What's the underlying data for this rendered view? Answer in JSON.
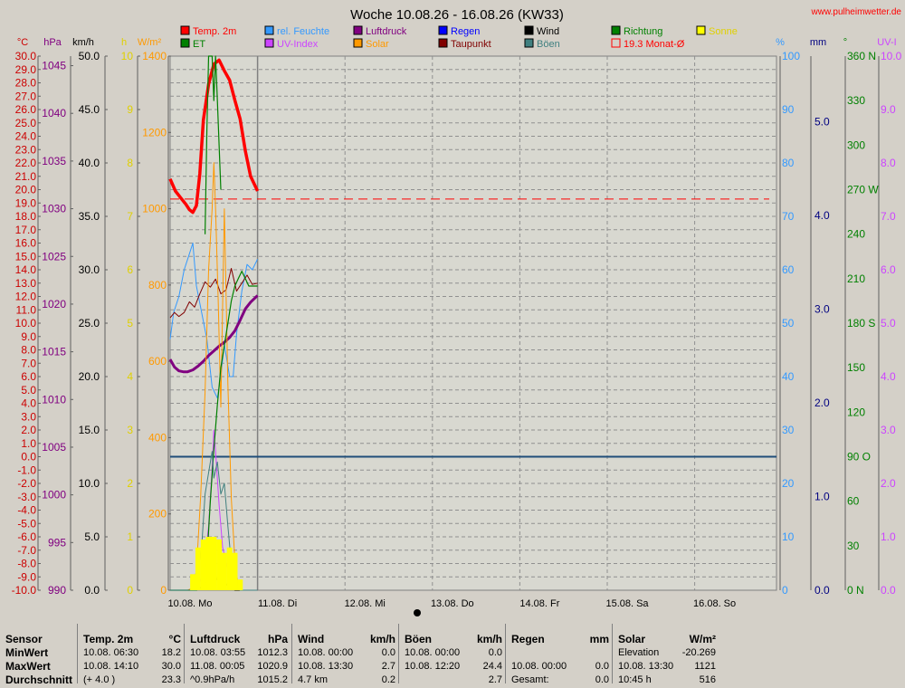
{
  "title": "Woche 10.08.26 - 16.08.26 (KW33)",
  "website": "www.pulheimwetter.de",
  "legend": [
    {
      "label": "Temp. 2m",
      "color": "#ff0000"
    },
    {
      "label": "rel. Feuchte",
      "color": "#3399ff"
    },
    {
      "label": "Luftdruck",
      "color": "#800080"
    },
    {
      "label": "Regen",
      "color": "#0000ff"
    },
    {
      "label": "Wind",
      "color": "#000000"
    },
    {
      "label": "Richtung",
      "color": "#008000"
    },
    {
      "label": "Sonne",
      "color": "#ffff00"
    },
    {
      "label": "ET",
      "color": "#008000"
    },
    {
      "label": "UV-Index",
      "color": "#cc44ff"
    },
    {
      "label": "Solar",
      "color": "#ff9900"
    },
    {
      "label": "Taupunkt",
      "color": "#800000"
    },
    {
      "label": "Böen",
      "color": "#408080"
    },
    {
      "label": "19.3 Monat-Ø",
      "color": "#ff0000"
    }
  ],
  "axis_units": {
    "temp": "°C",
    "pressure": "hPa",
    "wind": "km/h",
    "sun": "h",
    "solar": "W/m²",
    "humidity": "%",
    "rain": "mm",
    "direction": "°",
    "uv": "UV-I"
  },
  "chart_data": {
    "type": "line",
    "title": "Woche 10.08.26 - 16.08.26 (KW33)",
    "x_ticks": [
      "10.08. Mo",
      "11.08. Di",
      "12.08. Mi",
      "13.08. Do",
      "14.08. Fr",
      "15.08. Sa",
      "16.08. So"
    ],
    "axes": {
      "temp": {
        "min": -10,
        "max": 30,
        "ticks": [
          "30.0",
          "29.0",
          "28.0",
          "27.0",
          "26.0",
          "25.0",
          "24.0",
          "23.0",
          "22.0",
          "21.0",
          "20.0",
          "19.0",
          "18.0",
          "17.0",
          "16.0",
          "15.0",
          "14.0",
          "13.0",
          "12.0",
          "11.0",
          "10.0",
          "9.0",
          "8.0",
          "7.0",
          "6.0",
          "5.0",
          "4.0",
          "3.0",
          "2.0",
          "1.0",
          "0.0",
          "-1.0",
          "-2.0",
          "-3.0",
          "-4.0",
          "-5.0",
          "-6.0",
          "-7.0",
          "-8.0",
          "-9.0",
          "-10.0"
        ]
      },
      "pressure": {
        "min": 990,
        "max": 1046,
        "ticks": [
          "1045",
          "1040",
          "1035",
          "1030",
          "1025",
          "1020",
          "1015",
          "1010",
          "1005",
          "1000",
          "995",
          "990"
        ]
      },
      "wind": {
        "min": 0,
        "max": 50,
        "ticks": [
          "50.0",
          "45.0",
          "40.0",
          "35.0",
          "30.0",
          "25.0",
          "20.0",
          "15.0",
          "10.0",
          "5.0",
          "0.0"
        ]
      },
      "sun": {
        "min": 0,
        "max": 10,
        "ticks": [
          "10",
          "9",
          "8",
          "7",
          "6",
          "5",
          "4",
          "3",
          "2",
          "1",
          "0"
        ]
      },
      "solar": {
        "min": 0,
        "max": 1400,
        "ticks": [
          "1400",
          "1200",
          "1000",
          "800",
          "600",
          "400",
          "200",
          "0"
        ]
      },
      "humidity": {
        "min": 0,
        "max": 100,
        "ticks": [
          "100",
          "90",
          "80",
          "70",
          "60",
          "50",
          "40",
          "30",
          "20",
          "10",
          "0"
        ]
      },
      "rain": {
        "min": 0,
        "max": 5.7,
        "ticks": [
          "5.0",
          "4.0",
          "3.0",
          "2.0",
          "1.0",
          "0.0"
        ]
      },
      "direction": {
        "min": 0,
        "max": 360,
        "ticks": [
          "360 N",
          "330",
          "300",
          "270 W",
          "240",
          "210",
          "180 S",
          "150",
          "120",
          "90 O",
          "60",
          "30",
          "0 N"
        ]
      },
      "uv": {
        "min": 0,
        "max": 10,
        "ticks": [
          "10.0",
          "9.0",
          "8.0",
          "7.0",
          "6.0",
          "5.0",
          "4.0",
          "3.0",
          "2.0",
          "1.0",
          "0.0"
        ]
      }
    },
    "series": [
      {
        "name": "Temp. 2m",
        "axis": "temp",
        "color": "#ff0000",
        "x": [
          0,
          0.06,
          0.12,
          0.18,
          0.22,
          0.26,
          0.3,
          0.34,
          0.38,
          0.44,
          0.5,
          0.56,
          0.62,
          0.68,
          0.74,
          0.8,
          0.86,
          0.92,
          1.0
        ],
        "y": [
          20.8,
          19.9,
          19.4,
          18.9,
          18.5,
          18.3,
          18.8,
          21.2,
          25.2,
          27.9,
          29.4,
          29.7,
          28.9,
          28.2,
          26.7,
          25.3,
          22.9,
          21.0,
          19.9
        ]
      },
      {
        "name": "rel. Feuchte",
        "axis": "humidity",
        "color": "#3399ff",
        "x": [
          0,
          0.04,
          0.1,
          0.16,
          0.22,
          0.26,
          0.3,
          0.36,
          0.42,
          0.48,
          0.54,
          0.58,
          0.62,
          0.68,
          0.72,
          0.76,
          0.82,
          0.88,
          0.94,
          1.0
        ],
        "y": [
          47,
          52,
          55,
          60,
          63,
          65,
          57,
          52,
          47,
          38,
          36,
          40,
          46,
          40,
          40,
          48,
          56,
          61,
          60,
          62
        ]
      },
      {
        "name": "Luftdruck",
        "axis": "pressure",
        "color": "#800080",
        "x": [
          0,
          0.05,
          0.1,
          0.15,
          0.2,
          0.26,
          0.32,
          0.38,
          0.44,
          0.5,
          0.56,
          0.62,
          0.68,
          0.74,
          0.8,
          0.86,
          0.92,
          1.0
        ],
        "y": [
          1014.2,
          1013.4,
          1013.0,
          1012.9,
          1012.9,
          1013.1,
          1013.5,
          1014.0,
          1014.6,
          1015.1,
          1015.6,
          1016.0,
          1016.5,
          1017.2,
          1018.3,
          1019.5,
          1020.2,
          1020.9
        ]
      },
      {
        "name": "Taupunkt",
        "axis": "temp",
        "color": "#800000",
        "x": [
          0,
          0.05,
          0.1,
          0.16,
          0.22,
          0.28,
          0.34,
          0.4,
          0.46,
          0.52,
          0.58,
          0.64,
          0.7,
          0.76,
          0.82,
          0.88,
          0.94,
          1.0
        ],
        "y": [
          10.4,
          10.8,
          10.5,
          10.8,
          11.6,
          11.2,
          12.2,
          13.1,
          12.7,
          13.3,
          12.2,
          12.5,
          14.1,
          12.4,
          13.0,
          13.6,
          12.9,
          13.0
        ]
      },
      {
        "name": "Solar",
        "axis": "solar",
        "color": "#ff9900",
        "x": [
          0,
          0.1,
          0.2,
          0.25,
          0.3,
          0.35,
          0.4,
          0.44,
          0.48,
          0.5,
          0.52,
          0.55,
          0.58,
          0.62,
          0.66,
          0.7,
          0.74,
          0.78,
          0.8,
          0.84,
          0.9,
          1.0
        ],
        "y": [
          0,
          0,
          0,
          5,
          50,
          250,
          520,
          840,
          1000,
          1121,
          1000,
          760,
          480,
          1000,
          540,
          240,
          80,
          10,
          0,
          0,
          0,
          0
        ]
      },
      {
        "name": "UV-Index",
        "axis": "uv",
        "color": "#cc44ff",
        "x": [
          0,
          0.3,
          0.38,
          0.44,
          0.48,
          0.5,
          0.52,
          0.56,
          0.6,
          0.66,
          0.7,
          0.76,
          0.8,
          1.0
        ],
        "y": [
          0,
          0,
          0.3,
          1.2,
          2.3,
          3.0,
          2.6,
          1.6,
          0.8,
          0.4,
          0.1,
          0,
          0,
          0
        ]
      },
      {
        "name": "Richtung",
        "axis": "direction",
        "color": "#008000",
        "x": [
          0,
          0.2,
          0.3,
          0.36,
          0.42,
          0.46,
          0.5,
          0.54,
          0.58,
          0.62,
          0.66,
          0.7,
          0.74,
          0.78,
          0.82,
          0.86,
          0.9,
          1.0
        ],
        "y": [
          0,
          0,
          0,
          2,
          20,
          60,
          95,
          125,
          150,
          165,
          180,
          195,
          205,
          210,
          215,
          210,
          205,
          205
        ]
      },
      {
        "name": "Wind",
        "axis": "wind",
        "color": "#000000",
        "x": [
          0,
          0.3,
          0.36,
          0.42,
          0.48,
          0.52,
          0.56,
          0.6,
          0.66,
          0.7,
          0.74,
          1.0
        ],
        "y": [
          0,
          0,
          0.3,
          0.8,
          1.5,
          1.2,
          0.6,
          1.1,
          0.4,
          0.2,
          0,
          0
        ]
      },
      {
        "name": "Böen",
        "axis": "wind",
        "color": "#408080",
        "x": [
          0,
          0.3,
          0.36,
          0.4,
          0.44,
          0.48,
          0.5,
          0.54,
          0.58,
          0.62,
          0.66,
          0.7,
          0.76,
          0.8,
          1.0
        ],
        "y": [
          0,
          0,
          4,
          9,
          11,
          13,
          10.5,
          12,
          9,
          10,
          6,
          2.5,
          0.8,
          0,
          0
        ]
      },
      {
        "name": "Sonne",
        "axis": "sun",
        "color": "#ffff00",
        "type": "bars",
        "x": [
          0.26,
          0.32,
          0.38,
          0.44,
          0.5,
          0.56,
          0.62,
          0.68,
          0.74,
          0.8
        ],
        "y": [
          0.3,
          0.8,
          0.95,
          1.0,
          1.0,
          0.95,
          0.7,
          0.8,
          0.7,
          0.2
        ]
      },
      {
        "name": "ET",
        "axis": "direction",
        "color": "#008000",
        "x": [
          0.4,
          0.42,
          0.44,
          0.46,
          0.48,
          0.5,
          0.52,
          0.54,
          0.56,
          0.58
        ],
        "y": [
          240,
          310,
          370,
          380,
          360,
          330,
          360,
          330,
          300,
          270
        ]
      }
    ],
    "reference_lines": [
      {
        "name": "19.3 Monat-Ø",
        "axis": "temp",
        "value": 19.3,
        "color": "#ff0000",
        "style": "dashed"
      },
      {
        "name": "Regen",
        "axis": "temp",
        "value": 0,
        "color": "#1f4e79",
        "style": "solid"
      }
    ],
    "grid": true
  },
  "stats": {
    "sensor": {
      "header": "Sensor",
      "rows": [
        "MinWert",
        "MaxWert",
        "Durchschnitt"
      ]
    },
    "temp": {
      "header": "Temp. 2m",
      "unit": "°C",
      "rows": [
        [
          "10.08.  06:30",
          "18.2"
        ],
        [
          "10.08.  14:10",
          "30.0"
        ],
        [
          "(+ 4.0 )",
          "23.3"
        ]
      ]
    },
    "pressure": {
      "header": "Luftdruck",
      "unit": "hPa",
      "rows": [
        [
          "10.08.  03:55",
          "1012.3"
        ],
        [
          "11.08.  00:05",
          "1020.9"
        ],
        [
          "^0.9hPa/h",
          "1015.2"
        ]
      ]
    },
    "wind": {
      "header": "Wind",
      "unit": "km/h",
      "rows": [
        [
          "10.08.  00:00",
          "0.0"
        ],
        [
          "10.08.  13:30",
          "2.7"
        ],
        [
          "4.7 km",
          "0.2"
        ]
      ]
    },
    "gusts": {
      "header": "Böen",
      "unit": "km/h",
      "rows": [
        [
          "10.08.  00:00",
          "0.0"
        ],
        [
          "10.08.  12:20",
          "24.4"
        ],
        [
          "",
          "2.7"
        ]
      ]
    },
    "rain": {
      "header": "Regen",
      "unit": "mm",
      "rows": [
        [
          "",
          ""
        ],
        [
          "10.08.  00:00",
          "0.0"
        ],
        [
          "Gesamt:",
          "0.0"
        ]
      ]
    },
    "solar": {
      "header": "Solar",
      "unit": "W/m²",
      "rows": [
        [
          "Elevation",
          "-20.269"
        ],
        [
          "10.08.  13:30",
          "1121"
        ],
        [
          "10:45 h",
          "516"
        ]
      ]
    }
  }
}
